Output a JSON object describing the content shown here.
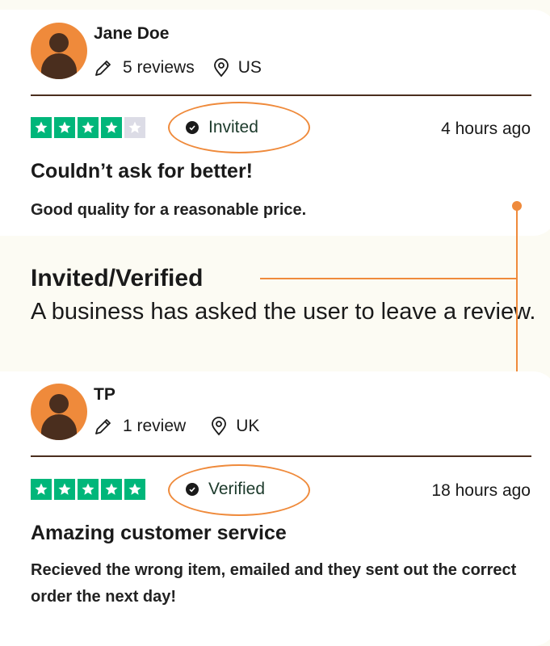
{
  "reviews": [
    {
      "name": "Jane Doe",
      "review_count": "5 reviews",
      "country": "US",
      "rating_stars": 4,
      "badge": "Invited",
      "time": "4 hours ago",
      "title": "Couldn’t ask for better!",
      "text": "Good quality for a reasonable price."
    },
    {
      "name": "TP",
      "review_count": "1 review",
      "country": "UK",
      "rating_stars": 5,
      "badge": "Verified",
      "time": "18 hours ago",
      "title": "Amazing customer service",
      "text": "Recieved the wrong item, emailed and they sent out the correct order the next day!"
    }
  ],
  "callout": {
    "heading": "Invited/Verified",
    "description": "A business has asked the user to leave a review."
  },
  "colors": {
    "accent": "#ef8a3b",
    "star_green": "#00b67a",
    "star_empty": "#dcdce6",
    "avatar_dark": "#4a2e1e",
    "background": "#fcfbf3"
  },
  "icons": [
    "avatar-icon",
    "pencil-icon",
    "location-pin-icon",
    "star-icon",
    "check-badge-icon"
  ]
}
